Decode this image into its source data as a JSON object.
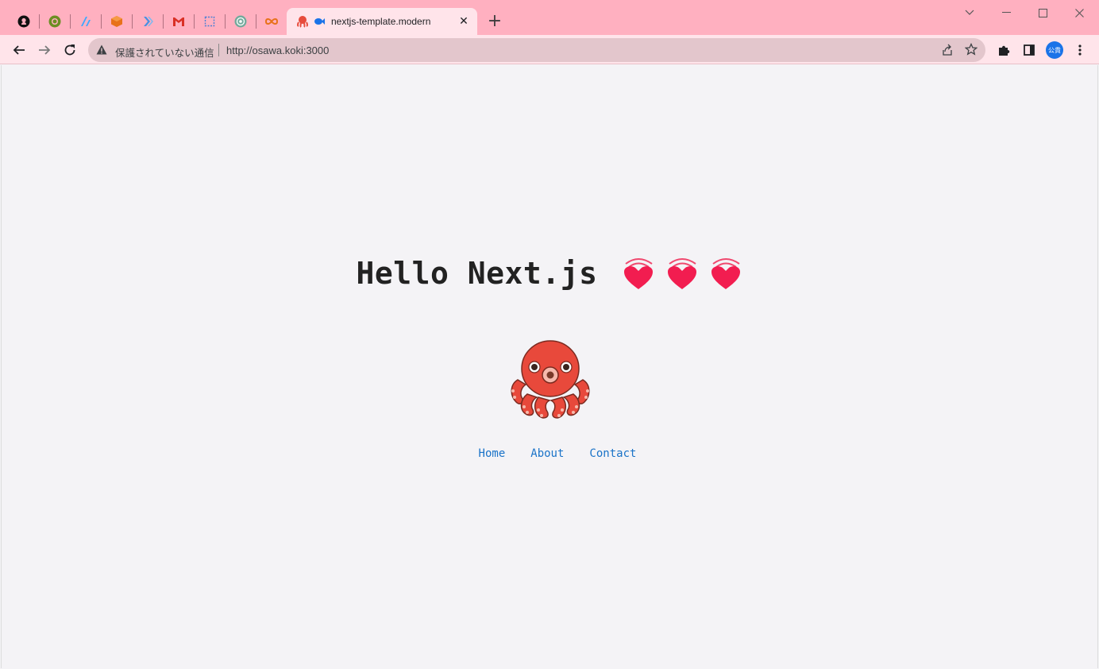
{
  "browser": {
    "pinned_tabs": [
      {
        "icon": "github-icon"
      },
      {
        "icon": "qiita-icon"
      },
      {
        "icon": "zenn-icon"
      },
      {
        "icon": "box-icon"
      },
      {
        "icon": "flutter-icon"
      },
      {
        "icon": "gmail-icon"
      },
      {
        "icon": "frame-icon"
      },
      {
        "icon": "chatgpt-icon"
      },
      {
        "icon": "infinity-icon"
      }
    ],
    "active_tab": {
      "title": "nextjs-template.modern",
      "icon": "octopus-icon"
    },
    "address_bar": {
      "security_text": "保護されていない通信",
      "url": "http://osawa.koki:3000"
    },
    "profile_label": "公貴",
    "accent_color": "#ffb0c0"
  },
  "page": {
    "title": "Hello Next.js",
    "hearts_count": 3,
    "nav": {
      "home": "Home",
      "about": "About",
      "contact": "Contact"
    },
    "link_color": "#1a73c8"
  }
}
